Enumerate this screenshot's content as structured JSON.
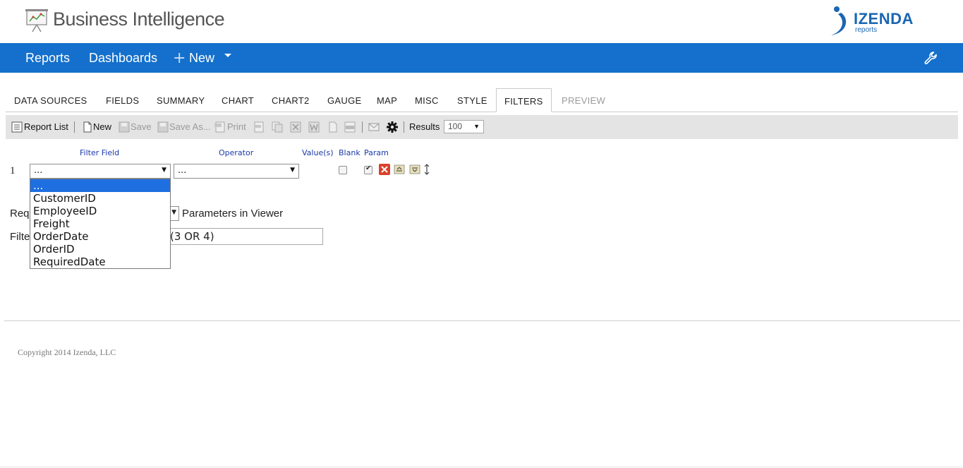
{
  "header": {
    "title": "Business Intelligence",
    "brand_name": "IZENDA",
    "brand_sub": "reports"
  },
  "nav": {
    "reports": "Reports",
    "dashboards": "Dashboards",
    "new": "New",
    "plus": "+"
  },
  "tabs": [
    {
      "label": "DATA SOURCES"
    },
    {
      "label": "FIELDS"
    },
    {
      "label": "SUMMARY"
    },
    {
      "label": "CHART"
    },
    {
      "label": "CHART2"
    },
    {
      "label": "GAUGE"
    },
    {
      "label": "MAP"
    },
    {
      "label": "MISC"
    },
    {
      "label": "STYLE"
    },
    {
      "label": "FILTERS"
    },
    {
      "label": "PREVIEW"
    }
  ],
  "toolbar": {
    "report_list": "Report List",
    "new": "New",
    "save": "Save",
    "save_as": "Save As...",
    "print": "Print",
    "results_label": "Results",
    "results_value": "100"
  },
  "filters": {
    "col_filter_field": "Filter Field",
    "col_operator": "Operator",
    "col_values": "Value(s)",
    "col_blank": "Blank",
    "col_param": "Param",
    "row_number": "1",
    "field_value": "...",
    "operator_value": "...",
    "options": [
      "...",
      "CustomerID",
      "EmployeeID",
      "Freight",
      "OrderDate",
      "OrderID",
      "RequiredDate"
    ],
    "required_label_fragment": "Req",
    "params_viewer": "Parameters in Viewer",
    "filter_label_fragment": "Filte",
    "filter_logic_value": "(3 OR 4)"
  },
  "footer": {
    "copyright": "Copyright 2014 Izenda, LLC"
  }
}
